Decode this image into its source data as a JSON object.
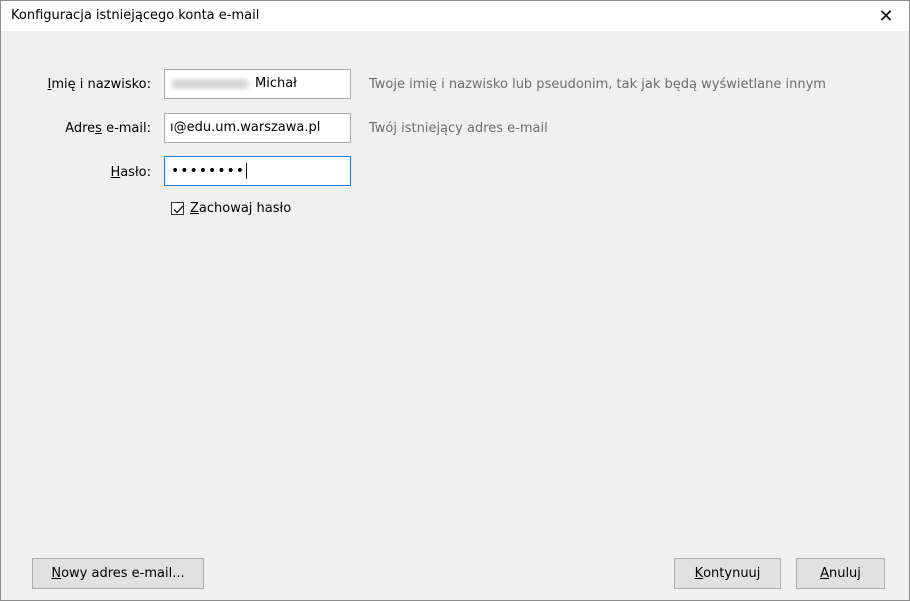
{
  "window": {
    "title": "Konfiguracja istniejącego konta e-mail",
    "close_symbol": "✕"
  },
  "form": {
    "name": {
      "label_first": "I",
      "label_rest": "mię i nazwisko:",
      "value": "Michał",
      "hint": "Twoje imię i nazwisko lub pseudonim, tak jak będą wyświetlane innym"
    },
    "email": {
      "label_pre": "Adre",
      "label_underlined": "s",
      "label_post": " e-mail:",
      "value": "ı@edu.um.warszawa.pl",
      "hint": "Twój istniejący adres e-mail"
    },
    "password": {
      "label_first": "H",
      "label_rest": "asło:",
      "value": "••••••••"
    },
    "remember": {
      "checked": true,
      "label_first": "Z",
      "label_rest": "achowaj hasło"
    }
  },
  "buttons": {
    "new_email": {
      "first": "N",
      "rest": "owy adres e-mail..."
    },
    "continue": {
      "first": "K",
      "rest": "ontynuuj"
    },
    "cancel": {
      "first": "A",
      "rest": "nuluj"
    }
  },
  "colors": {
    "focus_border": "#2a7bd4",
    "hint_text": "#6d6d6d",
    "dialog_bg": "#f0f0f0"
  }
}
